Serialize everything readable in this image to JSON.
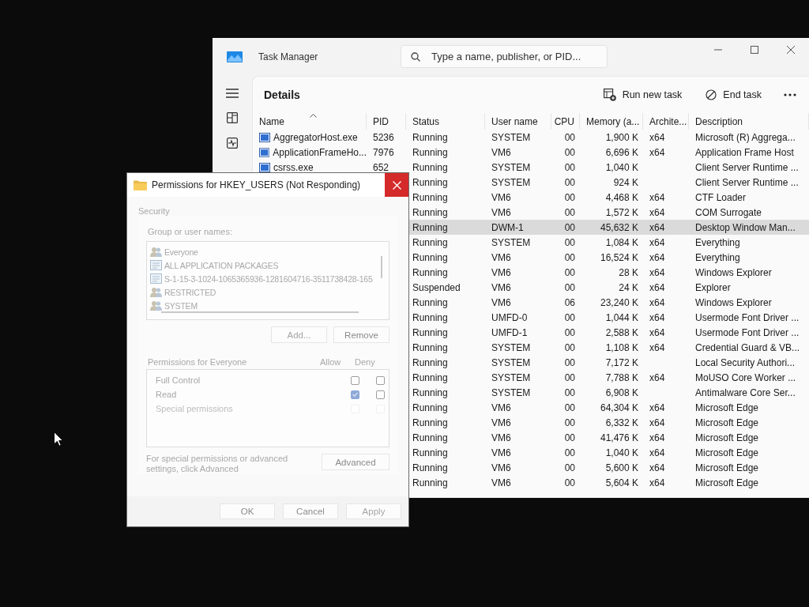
{
  "task_manager": {
    "title": "Task Manager",
    "search": {
      "placeholder": "Type a name, publisher, or PID..."
    },
    "page_title": "Details",
    "actions": [
      {
        "label": "Run new task",
        "kind": "run"
      },
      {
        "label": "End task",
        "kind": "end"
      }
    ],
    "columns": [
      {
        "label": "Name",
        "sorted": true
      },
      {
        "label": "PID",
        "sorted": false
      },
      {
        "label": "Status",
        "sorted": false
      },
      {
        "label": "User name",
        "sorted": false
      },
      {
        "label": "CPU",
        "sorted": false
      },
      {
        "label": "Memory (a...",
        "sorted": false
      },
      {
        "label": "Archite...",
        "sorted": false
      },
      {
        "label": "Description",
        "sorted": false
      }
    ],
    "rows": [
      {
        "name": "AggregatorHost.exe",
        "pid": "5236",
        "status": "Running",
        "user": "SYSTEM",
        "cpu": "00",
        "memory": "1,900 K",
        "arch": "x64",
        "description": "Microsoft (R) Aggrega...",
        "selected": false
      },
      {
        "name": "ApplicationFrameHo...",
        "pid": "7976",
        "status": "Running",
        "user": "VM6",
        "cpu": "00",
        "memory": "6,696 K",
        "arch": "x64",
        "description": "Application Frame Host",
        "selected": false
      },
      {
        "name": "csrss.exe",
        "pid": "652",
        "status": "Running",
        "user": "SYSTEM",
        "cpu": "00",
        "memory": "1,040 K",
        "description": "Client Server Runtime ...",
        "selected": false
      },
      {
        "status": "Running",
        "user": "SYSTEM",
        "cpu": "00",
        "memory": "924 K",
        "description": "Client Server Runtime ...",
        "selected": false
      },
      {
        "status": "Running",
        "user": "VM6",
        "cpu": "00",
        "memory": "4,468 K",
        "arch": "x64",
        "description": "CTF Loader",
        "selected": false
      },
      {
        "status": "Running",
        "user": "VM6",
        "cpu": "00",
        "memory": "1,572 K",
        "arch": "x64",
        "description": "COM Surrogate",
        "selected": false
      },
      {
        "status": "Running",
        "user": "DWM-1",
        "cpu": "00",
        "memory": "45,632 K",
        "arch": "x64",
        "description": "Desktop Window Man...",
        "selected": true
      },
      {
        "status": "Running",
        "user": "SYSTEM",
        "cpu": "00",
        "memory": "1,084 K",
        "arch": "x64",
        "description": "Everything",
        "selected": false
      },
      {
        "status": "Running",
        "user": "VM6",
        "cpu": "00",
        "memory": "16,524 K",
        "arch": "x64",
        "description": "Everything",
        "selected": false
      },
      {
        "status": "Running",
        "user": "VM6",
        "cpu": "00",
        "memory": "28 K",
        "arch": "x64",
        "description": "Windows Explorer",
        "selected": false
      },
      {
        "status": "Suspended",
        "user": "VM6",
        "cpu": "00",
        "memory": "24 K",
        "arch": "x64",
        "description": "Explorer",
        "selected": false
      },
      {
        "status": "Running",
        "user": "VM6",
        "cpu": "06",
        "memory": "23,240 K",
        "arch": "x64",
        "description": "Windows Explorer",
        "selected": false
      },
      {
        "status": "Running",
        "user": "UMFD-0",
        "cpu": "00",
        "memory": "1,044 K",
        "arch": "x64",
        "description": "Usermode Font Driver ...",
        "selected": false
      },
      {
        "status": "Running",
        "user": "UMFD-1",
        "cpu": "00",
        "memory": "2,588 K",
        "arch": "x64",
        "description": "Usermode Font Driver ...",
        "selected": false
      },
      {
        "status": "Running",
        "user": "SYSTEM",
        "cpu": "00",
        "memory": "1,108 K",
        "arch": "x64",
        "description": "Credential Guard & VB...",
        "selected": false
      },
      {
        "status": "Running",
        "user": "SYSTEM",
        "cpu": "00",
        "memory": "7,172 K",
        "description": "Local Security Authori...",
        "selected": false
      },
      {
        "status": "Running",
        "user": "SYSTEM",
        "cpu": "00",
        "memory": "7,788 K",
        "arch": "x64",
        "description": "MoUSO Core Worker ...",
        "selected": false
      },
      {
        "status": "Running",
        "user": "SYSTEM",
        "cpu": "00",
        "memory": "6,908 K",
        "description": "Antimalware Core Ser...",
        "selected": false
      },
      {
        "status": "Running",
        "user": "VM6",
        "cpu": "00",
        "memory": "64,304 K",
        "arch": "x64",
        "description": "Microsoft Edge",
        "selected": false
      },
      {
        "status": "Running",
        "user": "VM6",
        "cpu": "00",
        "memory": "6,332 K",
        "arch": "x64",
        "description": "Microsoft Edge",
        "selected": false
      },
      {
        "status": "Running",
        "user": "VM6",
        "cpu": "00",
        "memory": "41,476 K",
        "arch": "x64",
        "description": "Microsoft Edge",
        "selected": false
      },
      {
        "status": "Running",
        "user": "VM6",
        "cpu": "00",
        "memory": "1,040 K",
        "arch": "x64",
        "description": "Microsoft Edge",
        "selected": false
      },
      {
        "status": "Running",
        "user": "VM6",
        "cpu": "00",
        "memory": "5,600 K",
        "arch": "x64",
        "description": "Microsoft Edge",
        "selected": false
      },
      {
        "status": "Running",
        "user": "VM6",
        "cpu": "00",
        "memory": "5,604 K",
        "arch": "x64",
        "description": "Microsoft Edge",
        "selected": false
      }
    ]
  },
  "dialog": {
    "title": "Permissions for HKEY_USERS (Not Responding)",
    "tab": "Security",
    "group_label": "Group or user names:",
    "groups": [
      {
        "name": "Everyone",
        "kind": "user"
      },
      {
        "name": "ALL APPLICATION PACKAGES",
        "kind": "package"
      },
      {
        "name": "S-1-15-3-1024-1065365936-1281604716-3511738428-165",
        "kind": "package"
      },
      {
        "name": "RESTRICTED",
        "kind": "user"
      },
      {
        "name": "SYSTEM",
        "kind": "user"
      }
    ],
    "group_buttons": [
      {
        "label": "Add...",
        "disabled": true
      },
      {
        "label": "Remove",
        "disabled": false
      }
    ],
    "permissions_label": "Permissions for Everyone",
    "allow_label": "Allow",
    "deny_label": "Deny",
    "permissions": [
      {
        "label": "Full Control",
        "allow": false,
        "deny": false,
        "disabled": false
      },
      {
        "label": "Read",
        "allow": true,
        "deny": false,
        "disabled": false
      },
      {
        "label": "Special permissions",
        "allow": false,
        "deny": false,
        "disabled": true
      }
    ],
    "advanced_note": "For special permissions or advanced settings, click Advanced",
    "advanced_button": {
      "label": "Advanced",
      "disabled": false
    },
    "buttons": [
      {
        "label": "OK",
        "disabled": false
      },
      {
        "label": "Cancel",
        "disabled": false
      },
      {
        "label": "Apply",
        "disabled": true
      }
    ]
  }
}
